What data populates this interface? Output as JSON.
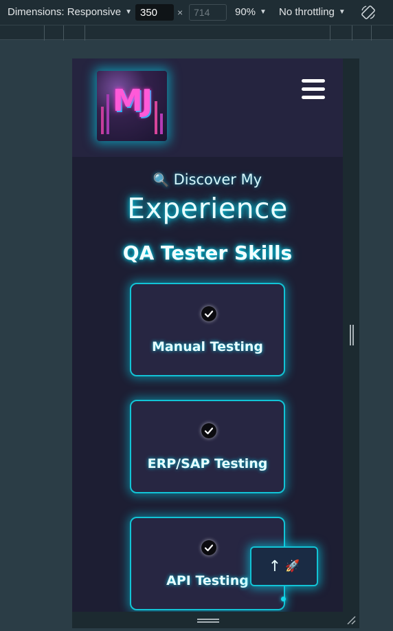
{
  "devtools": {
    "dimensions_label": "Dimensions: Responsive",
    "width_value": "350",
    "height_placeholder": "714",
    "times": "×",
    "zoom": "90%",
    "throttling": "No throttling",
    "caret": "▼"
  },
  "header": {
    "logo_text": "MJ"
  },
  "main": {
    "discover_icon": "🔍",
    "discover_text": "Discover My",
    "headline": "Experience",
    "section_title": "QA Tester Skills",
    "skills": [
      {
        "label": "Manual Testing",
        "icon": "check-circle-icon"
      },
      {
        "label": "ERP/SAP Testing",
        "icon": "check-circle-icon"
      },
      {
        "label": "API Testing",
        "icon": "check-circle-icon"
      }
    ]
  },
  "scroll_top": {
    "arrow": "↑",
    "rocket": "🚀"
  },
  "colors": {
    "accent": "#12c4d6",
    "page_bg": "#1d1e33",
    "header_bg": "#25243f"
  }
}
